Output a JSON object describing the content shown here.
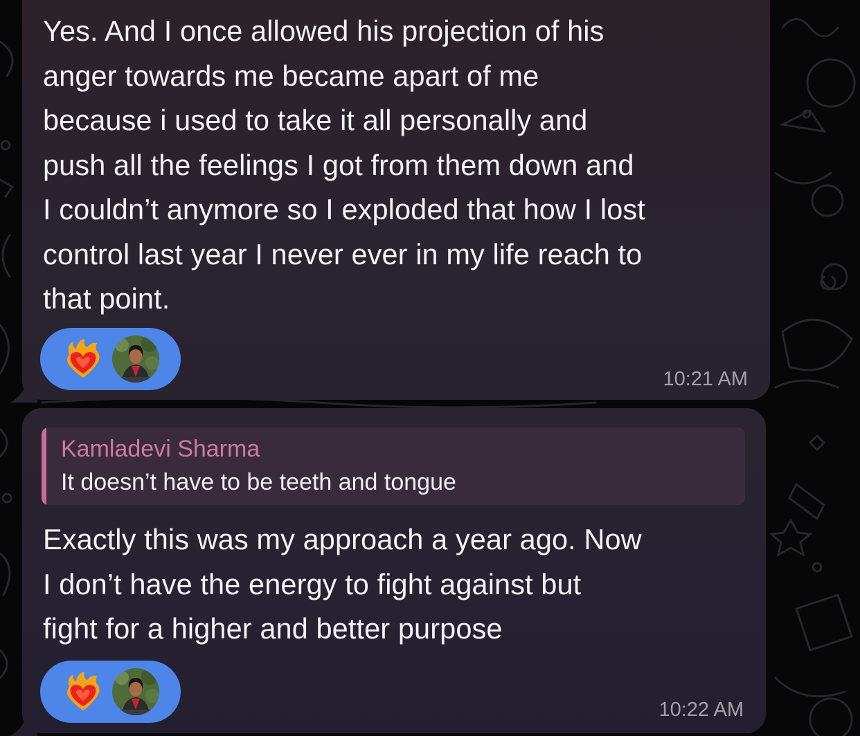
{
  "messages": [
    {
      "text": "Yes. And I once allowed his projection of his\nanger towards me became apart of me\nbecause i used to take it all personally and\npush all the feelings I got from them down and\nI couldn’t anymore so I exploded that how I lost\ncontrol last year I never ever in my life reach to\nthat point.",
      "reaction": {
        "emoji_icon": "heart-on-fire-icon",
        "reactor_avatar": "avatar"
      },
      "time": "10:21 AM"
    },
    {
      "reply_to": {
        "author": "Kamladevi Sharma",
        "text": "It doesn’t have to be teeth and tongue"
      },
      "text": "Exactly this was my approach a year ago. Now\nI don’t have the energy to fight against but\nfight for a higher and better purpose",
      "reaction": {
        "emoji_icon": "heart-on-fire-icon",
        "reactor_avatar": "avatar"
      },
      "time": "10:22 AM"
    }
  ],
  "colors": {
    "background": "#070708",
    "bubble": "#2a2430",
    "reaction_pill": "#4d86e8",
    "quote_accent": "#c76e98",
    "timestamp": "#a39fab"
  }
}
